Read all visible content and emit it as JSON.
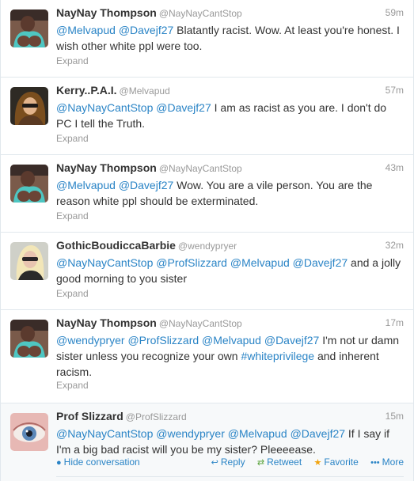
{
  "tweets": [
    {
      "fullname": "NayNay Thompson",
      "username": "@NayNayCantStop",
      "time": "59m",
      "text_parts": [
        {
          "t": "@Melvapud",
          "m": true
        },
        {
          "t": " ",
          "m": false
        },
        {
          "t": "@Davejf27",
          "m": true
        },
        {
          "t": " Blatantly racist. Wow. At least you're honest. I wish other white ppl were too.",
          "m": false
        }
      ],
      "expand": "Expand",
      "avatar": "naynay"
    },
    {
      "fullname": "Kerry..P.A.I.",
      "username": "@Melvapud",
      "time": "57m",
      "text_parts": [
        {
          "t": "@NayNayCantStop",
          "m": true
        },
        {
          "t": " ",
          "m": false
        },
        {
          "t": "@Davejf27",
          "m": true
        },
        {
          "t": " I am as racist as you are. I don't do PC I tell the Truth.",
          "m": false
        }
      ],
      "expand": "Expand",
      "avatar": "kerry"
    },
    {
      "fullname": "NayNay Thompson",
      "username": "@NayNayCantStop",
      "time": "43m",
      "text_parts": [
        {
          "t": "@Melvapud",
          "m": true
        },
        {
          "t": " ",
          "m": false
        },
        {
          "t": "@Davejf27",
          "m": true
        },
        {
          "t": " Wow. You are a vile person. You are the reason white ppl should be exterminated.",
          "m": false
        }
      ],
      "expand": "Expand",
      "avatar": "naynay"
    },
    {
      "fullname": "GothicBoudiccaBarbie",
      "username": "@wendypryer",
      "time": "32m",
      "text_parts": [
        {
          "t": "@NayNayCantStop",
          "m": true
        },
        {
          "t": " ",
          "m": false
        },
        {
          "t": "@ProfSlizzard",
          "m": true
        },
        {
          "t": " ",
          "m": false
        },
        {
          "t": "@Melvapud",
          "m": true
        },
        {
          "t": " ",
          "m": false
        },
        {
          "t": "@Davejf27",
          "m": true
        },
        {
          "t": " and a jolly good morning to you sister",
          "m": false
        }
      ],
      "expand": "Expand",
      "avatar": "gothic"
    },
    {
      "fullname": "NayNay Thompson",
      "username": "@NayNayCantStop",
      "time": "17m",
      "text_parts": [
        {
          "t": "@wendypryer",
          "m": true
        },
        {
          "t": " ",
          "m": false
        },
        {
          "t": "@ProfSlizzard",
          "m": true
        },
        {
          "t": " ",
          "m": false
        },
        {
          "t": "@Melvapud",
          "m": true
        },
        {
          "t": " ",
          "m": false
        },
        {
          "t": "@Davejf27",
          "m": true
        },
        {
          "t": " I'm not ur damn sister unless you recognize your own ",
          "m": false
        },
        {
          "t": "#whiteprivilege",
          "m": true
        },
        {
          "t": " and inherent racism.",
          "m": false
        }
      ],
      "expand": "Expand",
      "avatar": "naynay"
    },
    {
      "fullname": "Prof Slizzard",
      "username": "@ProfSlizzard",
      "time": "15m",
      "text_parts": [
        {
          "t": "@NayNayCantStop",
          "m": true
        },
        {
          "t": " ",
          "m": false
        },
        {
          "t": "@wendypryer",
          "m": true
        },
        {
          "t": " ",
          "m": false
        },
        {
          "t": "@Melvapud",
          "m": true
        },
        {
          "t": " ",
          "m": false
        },
        {
          "t": "@Davejf27",
          "m": true
        },
        {
          "t": " If I say if I'm a big bad racist will you be my sister? Pleeeease.",
          "m": false
        }
      ],
      "avatar": "prof",
      "actions": {
        "hide": "Hide conversation",
        "reply": "Reply",
        "retweet": "Retweet",
        "favorite": "Favorite",
        "more": "More"
      }
    }
  ],
  "colors": {
    "link": "#2a84c6",
    "muted": "#999999",
    "text": "#333333",
    "border": "#e1e8ed",
    "favorite": "#f1a30d"
  }
}
